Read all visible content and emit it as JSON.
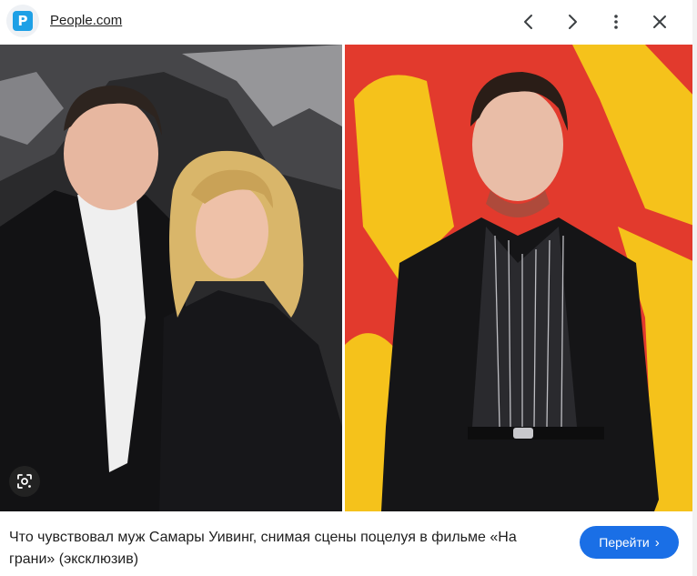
{
  "header": {
    "favicon_letter": "P",
    "source": "People.com"
  },
  "icons": {
    "prev": "chevron-left-icon",
    "next": "chevron-right-icon",
    "more": "more-vert-icon",
    "close": "close-icon",
    "lens": "google-lens-icon"
  },
  "caption": {
    "title": "Что чувствовал муж Самары Уивинг, снимая сцены поцелуя в фильме «На грани» (эксклюзив)"
  },
  "action": {
    "go_label": "Перейти",
    "go_arrow": "›"
  },
  "colors": {
    "accent": "#1a6fe6",
    "favicon": "#1ea0e6",
    "right_backdrop": "#e23a2d",
    "right_backdrop_yellow": "#f5c21b"
  }
}
